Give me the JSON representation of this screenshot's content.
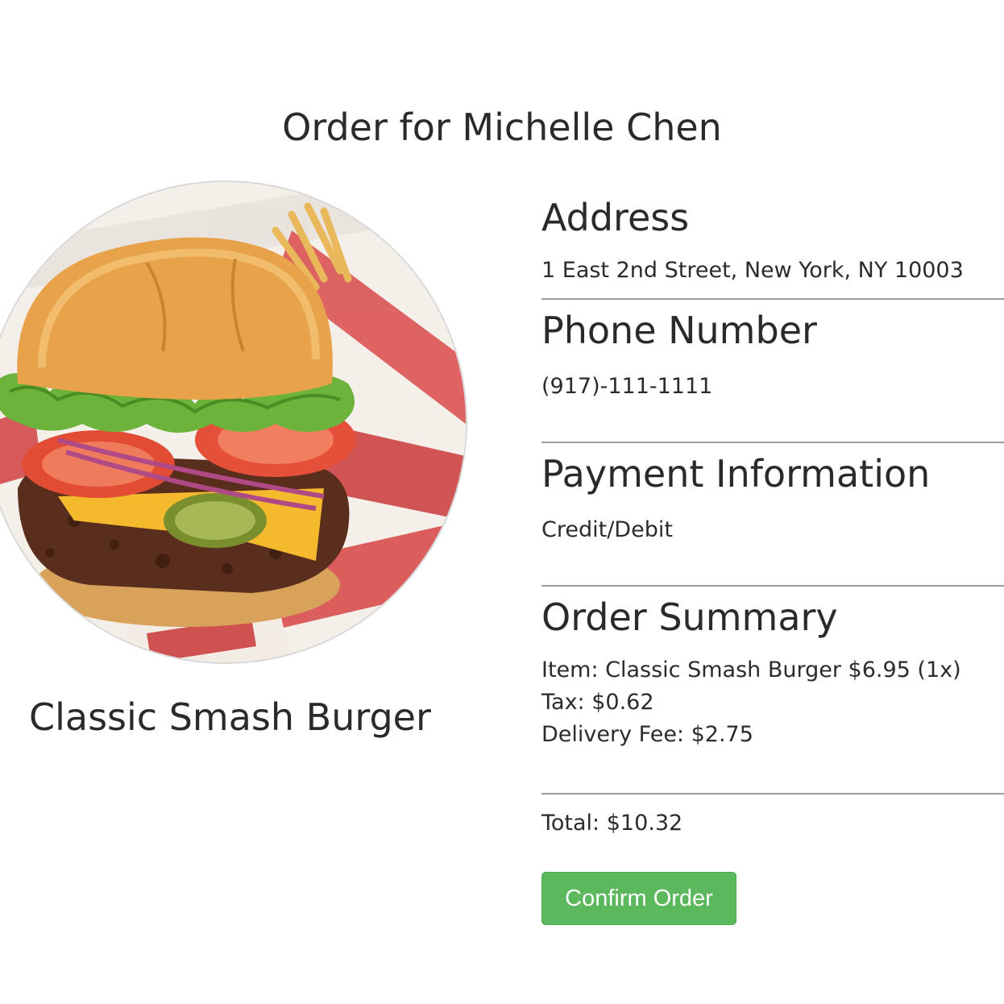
{
  "page": {
    "title": "Order for Michelle Chen"
  },
  "item": {
    "name": "Classic Smash Burger",
    "image": "burger-photo"
  },
  "address": {
    "heading": "Address",
    "value": "1 East 2nd Street, New York, NY 10003"
  },
  "phone": {
    "heading": "Phone Number",
    "value": "(917)-111-1111"
  },
  "payment": {
    "heading": "Payment Information",
    "value": "Credit/Debit"
  },
  "summary": {
    "heading": "Order Summary",
    "item_line": "Item: Classic Smash Burger $6.95 (1x)",
    "tax_line": "Tax: $0.62",
    "delivery_line": "Delivery Fee: $2.75",
    "total_line": "Total: $10.32"
  },
  "actions": {
    "confirm_label": "Confirm Order"
  },
  "colors": {
    "confirm_button": "#5cb85c",
    "divider": "#9a9a9a"
  }
}
